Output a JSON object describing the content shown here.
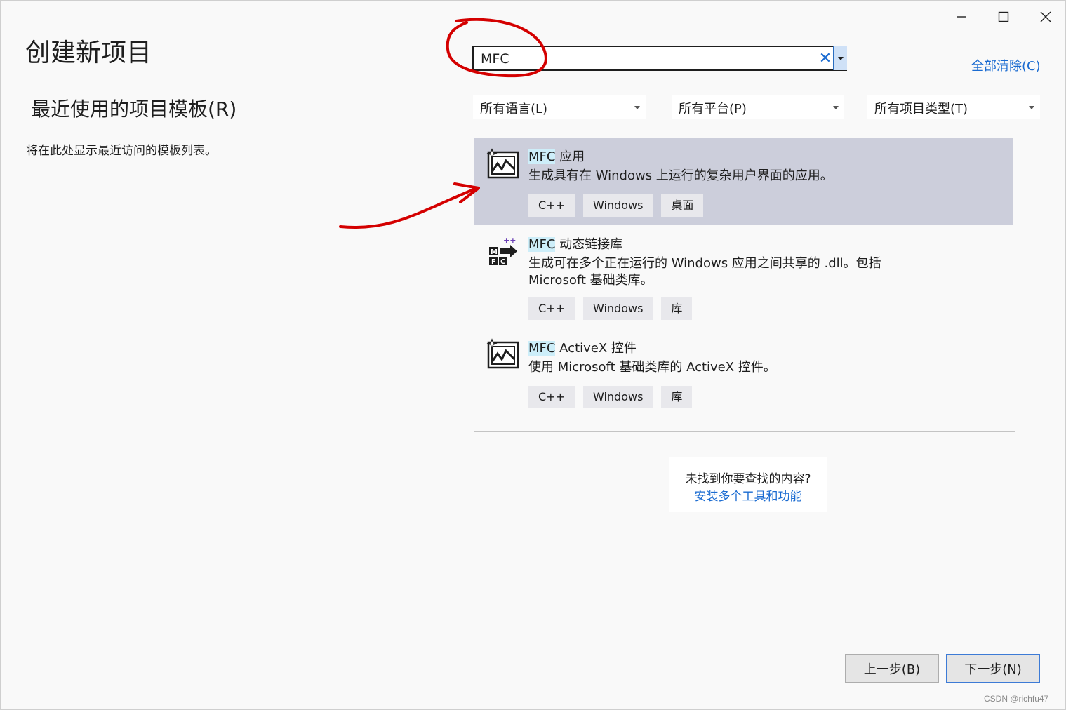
{
  "window_controls": {
    "minimize": "—",
    "maximize": "☐",
    "close": "✕"
  },
  "page_title": "创建新项目",
  "recent": {
    "title": "最近使用的项目模板(R)",
    "empty_text": "将在此处显示最近访问的模板列表。"
  },
  "search": {
    "value": "MFC",
    "clear_glyph": "✕"
  },
  "clear_all_label": "全部清除(C)",
  "filters": {
    "language": "所有语言(L)",
    "platform": "所有平台(P)",
    "project_type": "所有项目类型(T)"
  },
  "templates": [
    {
      "name_highlight": "MFC",
      "name_rest": " 应用",
      "description": "生成具有在 Windows 上运行的复杂用户界面的应用。",
      "tags": [
        "C++",
        "Windows",
        "桌面"
      ],
      "icon": "mfc-app-icon",
      "selected": true
    },
    {
      "name_highlight": "MFC",
      "name_rest": " 动态链接库",
      "description": "生成可在多个正在运行的 Windows 应用之间共享的 .dll。包括 Microsoft 基础类库。",
      "tags": [
        "C++",
        "Windows",
        "库"
      ],
      "icon": "mfc-dll-icon",
      "selected": false
    },
    {
      "name_highlight": "MFC",
      "name_rest": " ActiveX 控件",
      "description": "使用 Microsoft 基础类库的 ActiveX 控件。",
      "tags": [
        "C++",
        "Windows",
        "库"
      ],
      "icon": "mfc-activex-icon",
      "selected": false
    }
  ],
  "not_found": {
    "question": "未找到你要查找的内容?",
    "link": "安装多个工具和功能"
  },
  "buttons": {
    "back": "上一步(B)",
    "next": "下一步(N)"
  },
  "watermark": "CSDN @richfu47",
  "colors": {
    "accent": "#1a6bd1",
    "selected_row": "#cccedb",
    "annotation": "#d40000"
  }
}
